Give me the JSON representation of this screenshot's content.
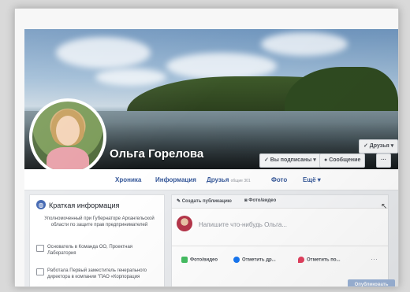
{
  "profile": {
    "name": "Ольга Горелова"
  },
  "cover_buttons": {
    "friends": "✓ Друзья ▾",
    "following": "✓ Вы подписаны ▾",
    "message": "Сообщение",
    "more": "···"
  },
  "tabs": [
    {
      "label": "Хроника"
    },
    {
      "label": "Информация"
    },
    {
      "label": "Друзья",
      "count": "общие 301"
    },
    {
      "label": "Фото"
    },
    {
      "label": "Ещё ▾"
    }
  ],
  "intro": {
    "title": "Краткая информация",
    "bio_line1": "Уполномоченный при Губернаторе Архангельской",
    "bio_line2": "области по защите прав предпринимателей",
    "work1_line1": "Основатель в Команда ОО, Проектная",
    "work1_line2": "Лаборатория",
    "work2_line1": "Работала Первый заместитель генерального",
    "work2_line2": "директора в компании \"ПАО «Корпорация"
  },
  "composer": {
    "create_post": "Создать публикацию",
    "photo_video_tab": "Фото/видео",
    "placeholder": "Напишите что-нибудь Ольга...",
    "action_photo": "Фото/видео",
    "action_tag": "Отметить др...",
    "action_checkin": "Отметить по...",
    "more": "···",
    "publish": "Опубликовать"
  },
  "colors": {
    "link_blue": "#365899",
    "brand_blue": "#4267b2"
  }
}
